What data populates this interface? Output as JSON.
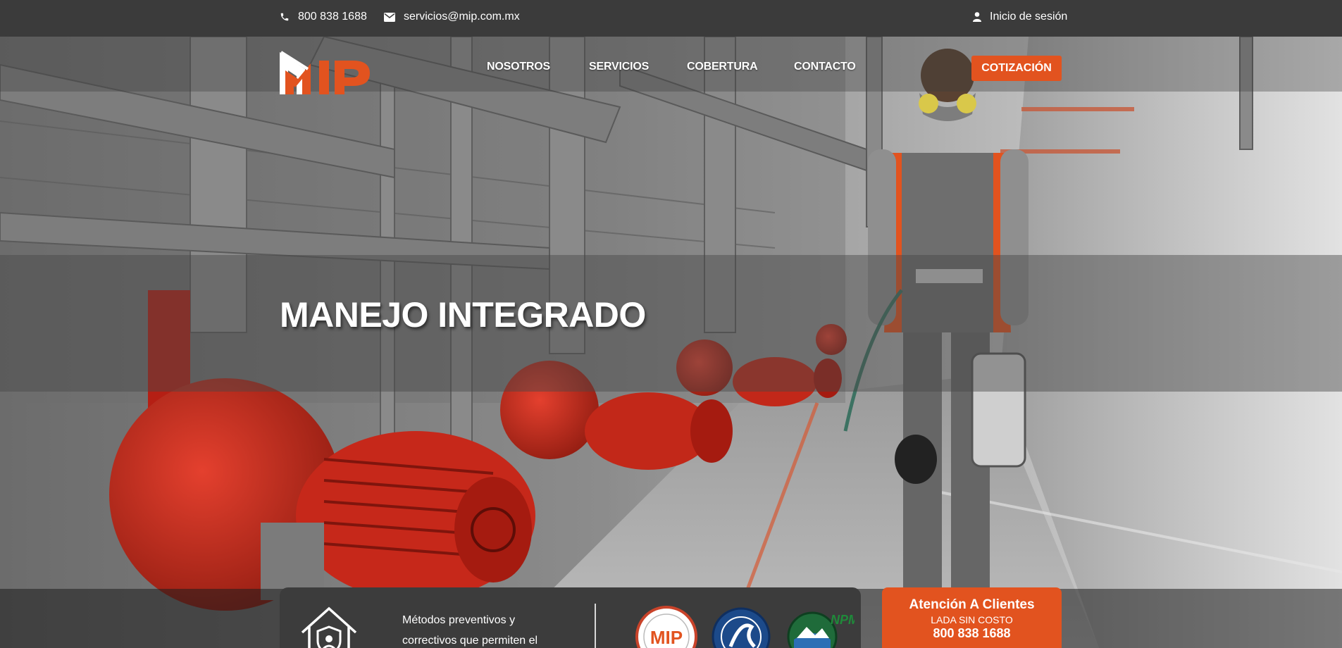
{
  "topbar": {
    "phone": "800 838 1688",
    "email": "servicios@mip.com.mx",
    "login": "Inicio de sesión",
    "icons": [
      "phone-icon",
      "envelope-icon",
      "user-icon"
    ]
  },
  "header": {
    "logo_text": "MIP",
    "nav": [
      "NOSOTROS",
      "SERVICIOS",
      "COBERTURA",
      "CONTACTO"
    ],
    "cta": "COTIZACIÓN"
  },
  "hero": {
    "title": "MANEJO INTEGRADO"
  },
  "feature": {
    "text": "Métodos preventivos y correctivos que permiten el",
    "icon": "house-shield-icon"
  },
  "badges": [
    {
      "name": "mip-pro-seal",
      "text": "MIP"
    },
    {
      "name": "association-seal",
      "text": ""
    },
    {
      "name": "npma-seal",
      "text": "NPM"
    }
  ],
  "client_box": {
    "title": "Atención A Clientes",
    "subtitle": "LADA SIN COSTO",
    "phone": "800 838 1688"
  },
  "colors": {
    "accent": "#e2531f",
    "topbar": "#3b3b3b",
    "card": "#3c3c3c"
  }
}
